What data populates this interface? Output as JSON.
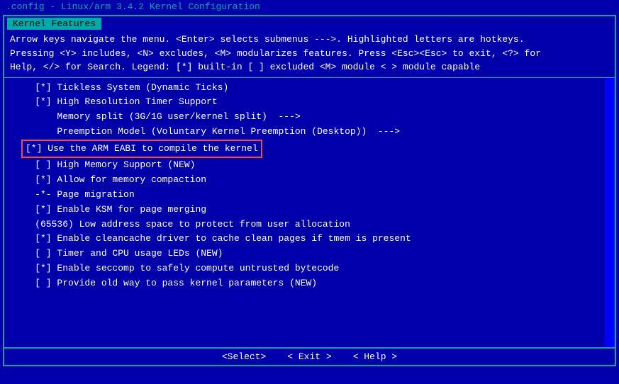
{
  "title_bar": {
    "text": ".config - Linux/arm 3.4.2 Kernel Configuration"
  },
  "tab": {
    "label": "Kernel Features"
  },
  "info_lines": [
    "Arrow keys navigate the menu.  <Enter> selects submenus --->.  Highlighted letters are hotkeys.",
    "Pressing <Y> includes, <N> excludes, <M> modularizes features.  Press <Esc><Esc> to exit, <?> for",
    "Help, </> for Search.  Legend: [*] built-in  [ ] excluded  <M> module  < > module capable"
  ],
  "menu_items": [
    {
      "id": 1,
      "text": "    [*] Tickless System (Dynamic Ticks)",
      "selected": false,
      "highlighted": false
    },
    {
      "id": 2,
      "text": "    [*] High Resolution Timer Support",
      "selected": false,
      "highlighted": false
    },
    {
      "id": 3,
      "text": "        Memory split (3G/1G user/kernel split)  --->",
      "selected": false,
      "highlighted": false
    },
    {
      "id": 4,
      "text": "        Preemption Model (Voluntary Kernel Preemption (Desktop))  --->",
      "selected": false,
      "highlighted": false
    },
    {
      "id": 5,
      "text": "[*] Use the ARM EABI to compile the kernel",
      "selected": true,
      "highlighted": true
    },
    {
      "id": 6,
      "text": "    [ ] High Memory Support (NEW)",
      "selected": false,
      "highlighted": false
    },
    {
      "id": 7,
      "text": "    [*] Allow for memory compaction",
      "selected": false,
      "highlighted": false
    },
    {
      "id": 8,
      "text": "    -*- Page migration",
      "selected": false,
      "highlighted": false
    },
    {
      "id": 9,
      "text": "    [*] Enable KSM for page merging",
      "selected": false,
      "highlighted": false
    },
    {
      "id": 10,
      "text": "    (65536) Low address space to protect from user allocation",
      "selected": false,
      "highlighted": false
    },
    {
      "id": 11,
      "text": "    [*] Enable cleancache driver to cache clean pages if tmem is present",
      "selected": false,
      "highlighted": false
    },
    {
      "id": 12,
      "text": "    [ ] Timer and CPU usage LEDs (NEW)",
      "selected": false,
      "highlighted": false
    },
    {
      "id": 13,
      "text": "    [*] Enable seccomp to safely compute untrusted bytecode",
      "selected": false,
      "highlighted": false
    },
    {
      "id": 14,
      "text": "    [ ] Provide old way to pass kernel parameters (NEW)",
      "selected": false,
      "highlighted": false
    }
  ],
  "bottom_buttons": [
    {
      "label": "<Select>"
    },
    {
      "label": "< Exit >"
    },
    {
      "label": "< Help >"
    }
  ]
}
